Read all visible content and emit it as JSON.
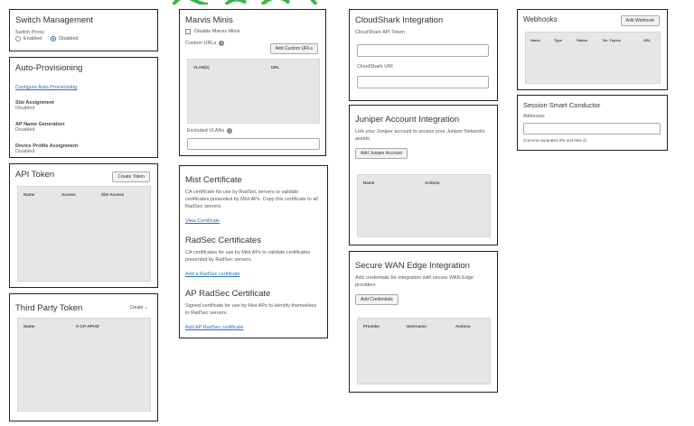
{
  "switch_mgmt": {
    "title": "Switch Management",
    "proxy_label": "Switch Proxy",
    "options": [
      "Enabled",
      "Disabled"
    ],
    "selected": "Disabled"
  },
  "auto_prov": {
    "title": "Auto-Provisioning",
    "link": "Configure Auto-Provisioning",
    "items": [
      {
        "label": "Site Assignment",
        "value": "Disabled"
      },
      {
        "label": "AP Name Generation",
        "value": "Disabled"
      },
      {
        "label": "Device Profile Assignment",
        "value": "Disabled"
      }
    ]
  },
  "api_token": {
    "title": "API Token",
    "button": "Create Token",
    "columns": [
      "Name",
      "Access",
      "Site Access"
    ]
  },
  "third_party": {
    "title": "Third Party Token",
    "button": "Create",
    "columns": [
      "Name",
      "X-CP-API-ID"
    ]
  },
  "marvis": {
    "title": "Marvis Minis",
    "checkbox": "Disable Marvis Minis",
    "custom_urls_label": "Custom URLs",
    "button": "Add Custom URLs",
    "columns": [
      "VLAN(s)",
      "URL"
    ],
    "excluded_label": "Excluded VLANs"
  },
  "mist_cert": {
    "title": "Mist Certificate",
    "desc": "CA certificate for use by RadSec servers to validate certificates presented by Mist APs. Copy this certificate to all RadSec servers.",
    "link": "View Certificate",
    "radsec_title": "RadSec Certificates",
    "radsec_desc": "CA certificates for use by Mist APs to validate certificates presented by RadSec servers.",
    "radsec_link": "Add a RadSec certificate",
    "ap_title": "AP RadSec Certificate",
    "ap_desc": "Signed certificate for use by Mist APs to identify themselves to RadSec servers.",
    "ap_link": "Add AP RadSec certificate"
  },
  "cloudshark": {
    "title": "CloudShark Integration",
    "token_label": "CloudShark API Token",
    "uri_label": "CloudShark URI"
  },
  "juniper": {
    "title": "Juniper Account Integration",
    "desc": "Link your Juniper account to access your Juniper Networks assets",
    "button": "Add Juniper Account",
    "columns": [
      "Name",
      "Actions"
    ]
  },
  "wan_edge": {
    "title": "Secure WAN Edge Integration",
    "desc": "Add credentials for integration with secure WAN Edge providers",
    "button": "Add Credentials",
    "columns": [
      "Provider",
      "Username",
      "Actions"
    ]
  },
  "webhooks": {
    "title": "Webhooks",
    "button": "Add Webhook",
    "columns": [
      "Name",
      "Type",
      "Status",
      "No. Topics",
      "URL"
    ]
  },
  "ssc": {
    "title": "Session Smart Conductor",
    "addresses_label": "Addresses",
    "hint": "(Comma separated IPs and Max 2)"
  },
  "colors": {
    "accent": "#2a6ebb",
    "partial_art": "#3bb54a"
  }
}
